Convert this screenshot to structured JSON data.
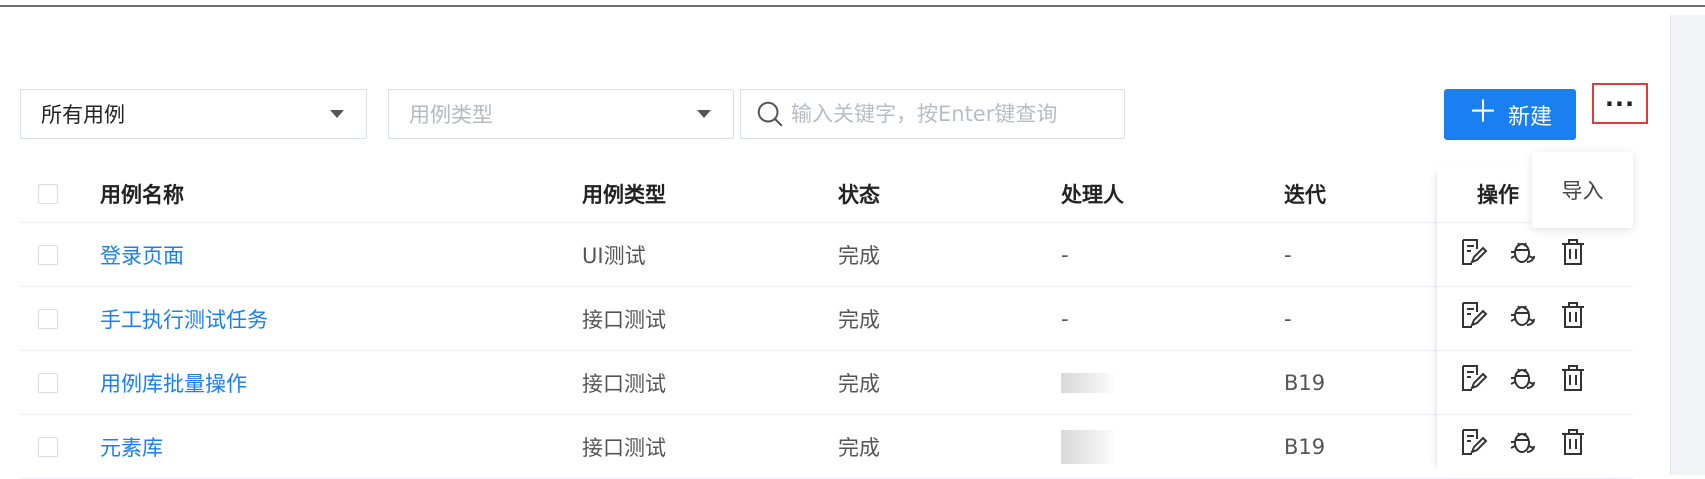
{
  "filters": {
    "scope_value": "所有用例",
    "type_placeholder": "用例类型",
    "search_placeholder": "输入关键字，按Enter键查询"
  },
  "toolbar": {
    "new_label": "新建",
    "more_label": "···",
    "more_menu": [
      "导入"
    ]
  },
  "table": {
    "headers": [
      "用例名称",
      "用例类型",
      "状态",
      "处理人",
      "迭代",
      "操作"
    ],
    "rows": [
      {
        "name": "登录页面",
        "type": "UI测试",
        "status": "完成",
        "owner": "-",
        "iteration": "-"
      },
      {
        "name": "手工执行测试任务",
        "type": "接口测试",
        "status": "完成",
        "owner": "-",
        "iteration": "-"
      },
      {
        "name": "用例库批量操作",
        "type": "接口测试",
        "status": "完成",
        "owner": "",
        "iteration": "B19"
      },
      {
        "name": "元素库",
        "type": "接口测试",
        "status": "完成",
        "owner": "",
        "iteration": "B19"
      }
    ]
  },
  "colors": {
    "accent": "#1a7ff0",
    "highlight_border": "#e03b3b"
  }
}
